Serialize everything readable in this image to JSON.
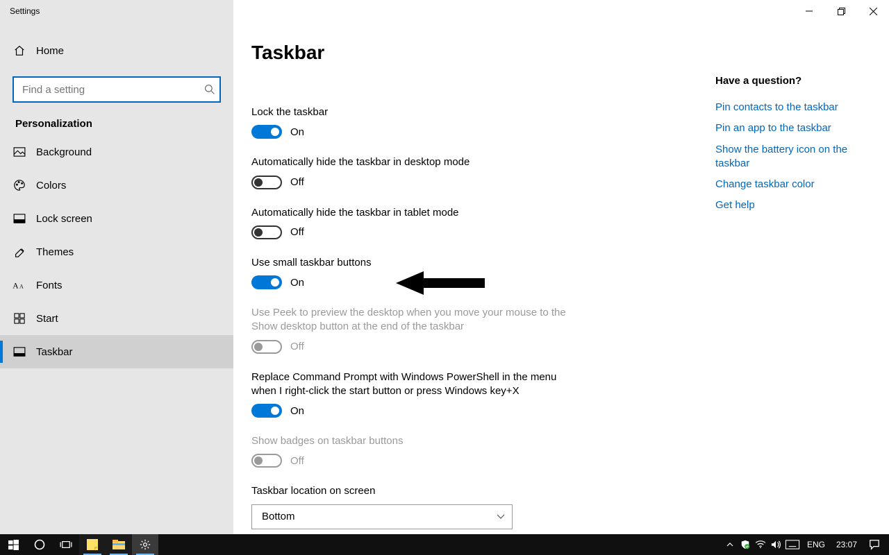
{
  "window": {
    "title": "Settings"
  },
  "captions": {
    "min": "—",
    "max": "❐",
    "close": "✕"
  },
  "home": {
    "label": "Home"
  },
  "search": {
    "placeholder": "Find a setting"
  },
  "section_title": "Personalization",
  "nav": [
    {
      "label": "Background",
      "icon": "image"
    },
    {
      "label": "Colors",
      "icon": "palette"
    },
    {
      "label": "Lock screen",
      "icon": "lockscreen"
    },
    {
      "label": "Themes",
      "icon": "themes"
    },
    {
      "label": "Fonts",
      "icon": "fonts"
    },
    {
      "label": "Start",
      "icon": "start"
    },
    {
      "label": "Taskbar",
      "icon": "taskbar",
      "active": true
    }
  ],
  "page_title": "Taskbar",
  "settings": [
    {
      "label": "Lock the taskbar",
      "state": "On",
      "on": true,
      "disabled": false
    },
    {
      "label": "Automatically hide the taskbar in desktop mode",
      "state": "Off",
      "on": false,
      "disabled": false
    },
    {
      "label": "Automatically hide the taskbar in tablet mode",
      "state": "Off",
      "on": false,
      "disabled": false
    },
    {
      "label": "Use small taskbar buttons",
      "state": "On",
      "on": true,
      "disabled": false
    },
    {
      "label": "Use Peek to preview the desktop when you move your mouse to the Show desktop button at the end of the taskbar",
      "state": "Off",
      "on": false,
      "disabled": true
    },
    {
      "label": "Replace Command Prompt with Windows PowerShell in the menu when I right-click the start button or press Windows key+X",
      "state": "On",
      "on": true,
      "disabled": false
    },
    {
      "label": "Show badges on taskbar buttons",
      "state": "Off",
      "on": false,
      "disabled": true
    }
  ],
  "location_label": "Taskbar location on screen",
  "location_value": "Bottom",
  "help": {
    "heading": "Have a question?",
    "links": [
      "Pin contacts to the taskbar",
      "Pin an app to the taskbar",
      "Show the battery icon on the taskbar",
      "Change taskbar color",
      "Get help"
    ]
  },
  "taskbar": {
    "lang": "ENG",
    "clock": "23:07"
  }
}
